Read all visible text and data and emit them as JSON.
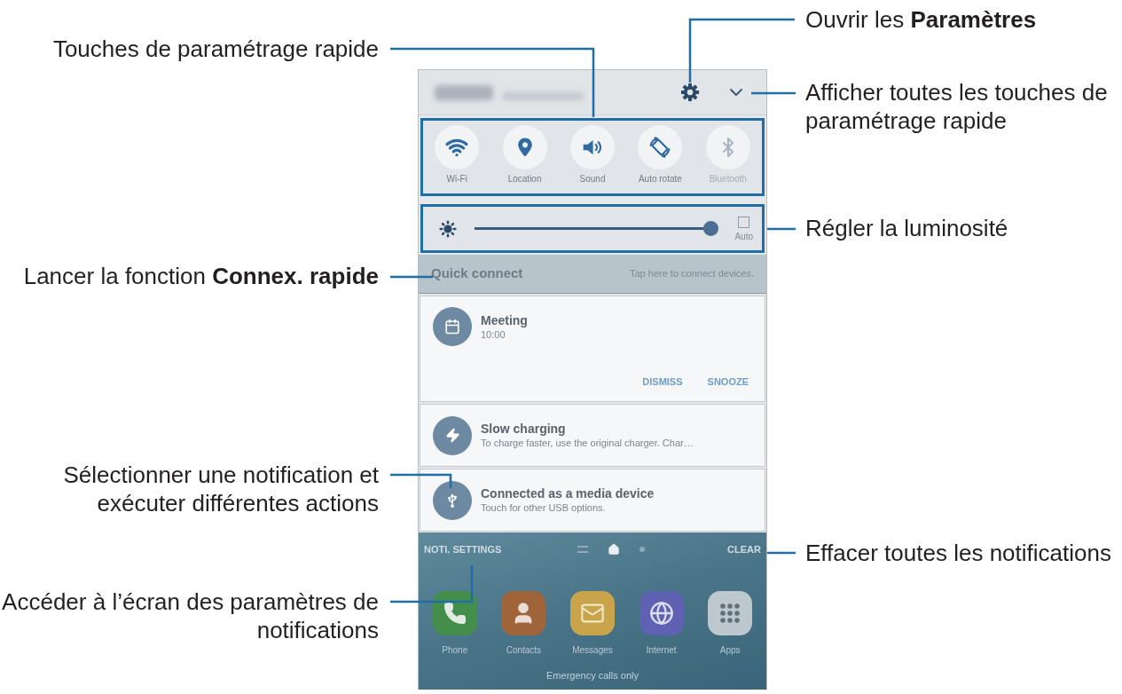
{
  "phone_screen": {
    "quick_settings": [
      {
        "kind": "wifi",
        "label": "Wi-Fi",
        "on": true
      },
      {
        "kind": "location",
        "label": "Location",
        "on": true
      },
      {
        "kind": "sound",
        "label": "Sound",
        "on": true
      },
      {
        "kind": "rotate",
        "label": "Auto rotate",
        "on": true
      },
      {
        "kind": "bluetooth",
        "label": "Bluetooth",
        "on": false
      }
    ],
    "brightness": {
      "level": 0.98,
      "auto": {
        "label": "Auto",
        "checked": false
      }
    },
    "quick_connect": {
      "title": "Quick connect",
      "hint": "Tap here to connect devices."
    },
    "notifications": [
      {
        "kind": "calendar",
        "title": "Meeting",
        "text": "10:00",
        "actions": [
          "DISMISS",
          "SNOOZE"
        ]
      },
      {
        "kind": "charging",
        "title": "Slow charging",
        "text": "To charge faster, use the original charger. Char…"
      },
      {
        "kind": "usb",
        "title": "Connected as a media device",
        "text": "Touch for other USB options."
      }
    ],
    "footer": {
      "settings": "NOTI. SETTINGS",
      "clear": "CLEAR"
    },
    "page_indicator": [
      {
        "kind": "list",
        "selected": false
      },
      {
        "kind": "home",
        "selected": true
      },
      {
        "kind": "page",
        "selected": false
      }
    ],
    "dock": [
      {
        "kind": "phone",
        "label": "Phone",
        "color": "#438e4b"
      },
      {
        "kind": "contacts",
        "label": "Contacts",
        "color": "#a0643b"
      },
      {
        "kind": "messages",
        "label": "Messages",
        "color": "#c9a44b"
      },
      {
        "kind": "internet",
        "label": "Internet",
        "color": "#5f62b2"
      },
      {
        "kind": "apps",
        "label": "Apps",
        "color": "#bcc7ce"
      }
    ],
    "status": "Emergency calls only"
  },
  "callouts": {
    "left": [
      {
        "lines": [
          "Touches de paramétrage rapide"
        ]
      },
      {
        "lines": [
          "Lancer la fonction **Connex. rapide**"
        ]
      },
      {
        "lines": [
          "Sélectionner une notification et",
          "exécuter différentes actions"
        ]
      },
      {
        "lines": [
          "Accéder à l’écran des paramètres de",
          "notifications"
        ]
      }
    ],
    "right": [
      {
        "lines": [
          "Ouvrir les **Paramètres**"
        ]
      },
      {
        "lines": [
          "Afficher toutes les touches de",
          "paramétrage rapide"
        ]
      },
      {
        "lines": [
          "Régler la luminosité"
        ]
      },
      {
        "lines": [
          "Effacer toutes les notifications"
        ]
      }
    ]
  }
}
